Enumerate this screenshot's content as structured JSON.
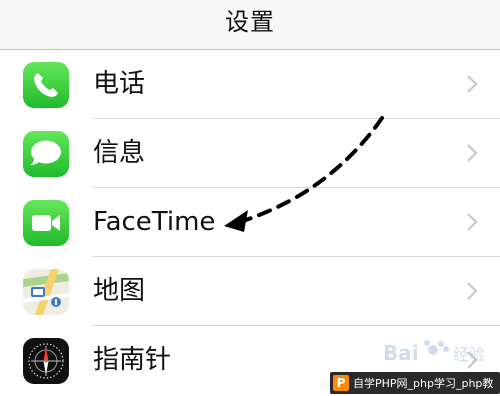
{
  "nav": {
    "title": "设置"
  },
  "settings": {
    "items": [
      {
        "label": "电话",
        "icon": "phone-icon",
        "color": "#4cd964"
      },
      {
        "label": "信息",
        "icon": "messages-icon",
        "color": "#4cd964"
      },
      {
        "label": "FaceTime",
        "icon": "facetime-icon",
        "color": "#4cd964"
      },
      {
        "label": "地图",
        "icon": "maps-icon",
        "color": "#e9e6dc"
      },
      {
        "label": "指南针",
        "icon": "compass-icon",
        "color": "#1c1c1e"
      }
    ]
  },
  "annotation": {
    "arrow": "dashed-arrow-pointing-to-facetime"
  },
  "footer": {
    "banner_text": "自学PHP网_php学习_php教",
    "logo_text": "Baidu 经验"
  }
}
